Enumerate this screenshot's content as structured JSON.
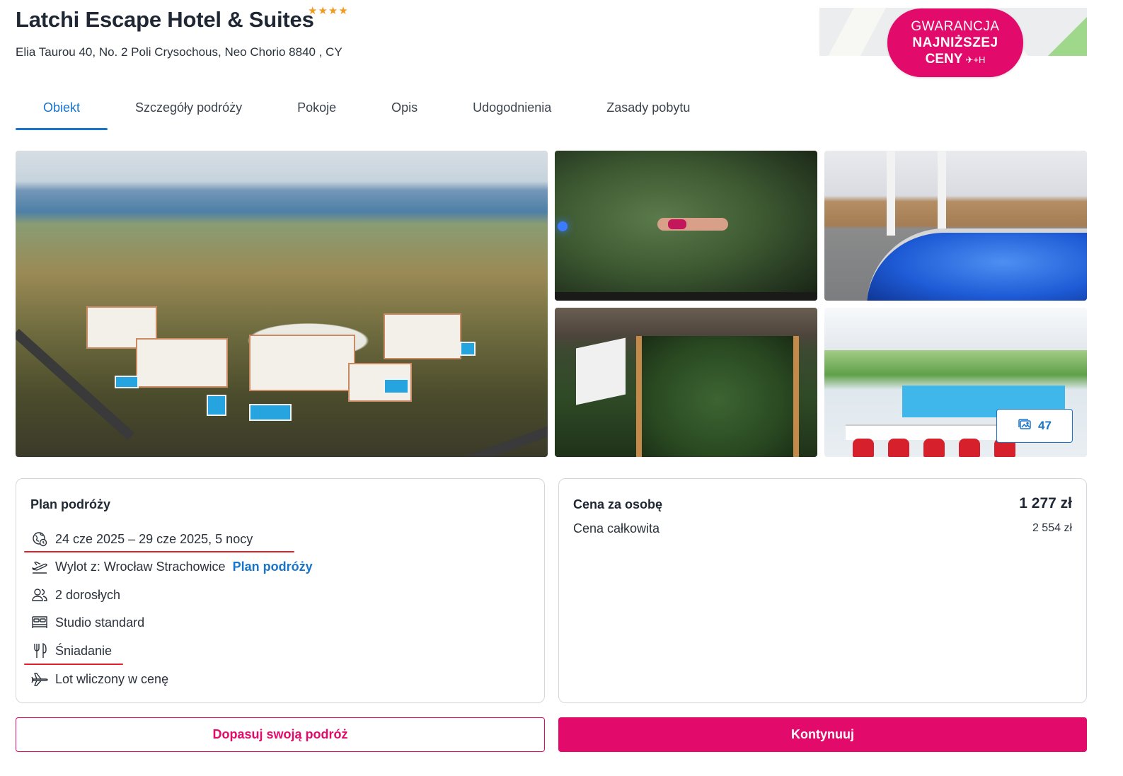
{
  "hotel": {
    "name": "Latchi Escape Hotel & Suites",
    "stars_display": "★★★★",
    "star_rating": 4,
    "address": "Elia Taurou 40, No. 2 Poli Crysochous, Neo Chorio 8840 , CY"
  },
  "badge": {
    "line1": "GWARANCJA",
    "line2": "NAJNIŻSZEJ",
    "line3": "CENY",
    "icons": "✈+H",
    "color": "#e20a6b"
  },
  "tabs": [
    {
      "label": "Obiekt",
      "active": true
    },
    {
      "label": "Szczegóły podróży",
      "active": false
    },
    {
      "label": "Pokoje",
      "active": false
    },
    {
      "label": "Opis",
      "active": false
    },
    {
      "label": "Udogodnienia",
      "active": false
    },
    {
      "label": "Zasady pobytu",
      "active": false
    }
  ],
  "gallery": {
    "count": "47",
    "icon": "gallery-icon"
  },
  "plan": {
    "title": "Plan podróży",
    "dates": "24 cze 2025 – 29 cze 2025, 5 nocy",
    "departure": "Wylot z: Wrocław Strachowice",
    "departure_link": "Plan podróży",
    "guests": "2 dorosłych",
    "room": "Studio standard",
    "board": "Śniadanie",
    "flight": "Lot wliczony w cenę"
  },
  "price": {
    "per_person_label": "Cena za osobę",
    "per_person_value": "1 277 zł",
    "total_label": "Cena całkowita",
    "total_value": "2 554 zł"
  },
  "buttons": {
    "customize": "Dopasuj swoją podróż",
    "continue": "Kontynuuj"
  },
  "colors": {
    "accent": "#e20a6b",
    "link": "#1875c9",
    "stars": "#f39a1d",
    "annotation": "#e2202a"
  }
}
